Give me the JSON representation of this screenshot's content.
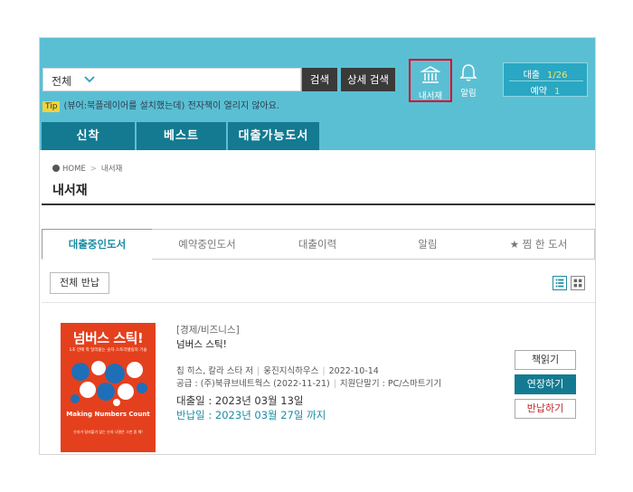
{
  "search": {
    "scope": "전체",
    "search_label": "검색",
    "advanced_label": "상세 검색",
    "tip_badge": "Tip",
    "tip_text": "(뷰어:북플레이어를 설치했는데) 전자책이 열리지 않아요."
  },
  "header": {
    "mybooks_label": "내서재",
    "alarm_label": "알림",
    "loan_label": "대출",
    "loan_value": "1/26",
    "reserve_label": "예약",
    "reserve_value": "1"
  },
  "nav": {
    "tabs": [
      "신착",
      "베스트",
      "대출가능도서"
    ]
  },
  "breadcrumb": {
    "home": "HOME",
    "current": "내서재"
  },
  "page_title": "내서재",
  "tabs": [
    "대출중인도서",
    "예약중인도서",
    "대출이력",
    "알림",
    "★ 찜 한 도서"
  ],
  "return_all_label": "전체 반납",
  "book": {
    "category": "[경제/비즈니스]",
    "title": "넘버스 스틱!",
    "authors": "칩 히스, 칼라 스타 저",
    "publisher": "웅진지식하우스",
    "pub_date": "2022-10-14",
    "supplier": "공급 : (주)북큐브네트웍스 (2022-11-21)",
    "support": "지원단말기 : PC/스마트기기",
    "loan_date": "대출일 : 2023년 03월 13일",
    "return_date": "반납일 : 2023년 03월 27일 까지",
    "cover_title": "넘버스 스틱!",
    "cover_subtitle": "1초 만에 착 달라붙는 숫자 스토리텔링의 기술",
    "cover_en": "Making Numbers Count",
    "cover_note": "숫자가 달라붙기 않는 숫자 나열은 그만 좀 해!"
  },
  "actions": {
    "read": "책읽기",
    "extend": "연장하기",
    "return": "반납하기"
  },
  "colors": {
    "header_bg": "#5bbfd3",
    "nav_tab_bg": "#137a91",
    "accent": "#1b8ba4",
    "highlight_border": "#e1001e",
    "return_text": "#c0282d",
    "cover_bg": "#e4401e"
  }
}
